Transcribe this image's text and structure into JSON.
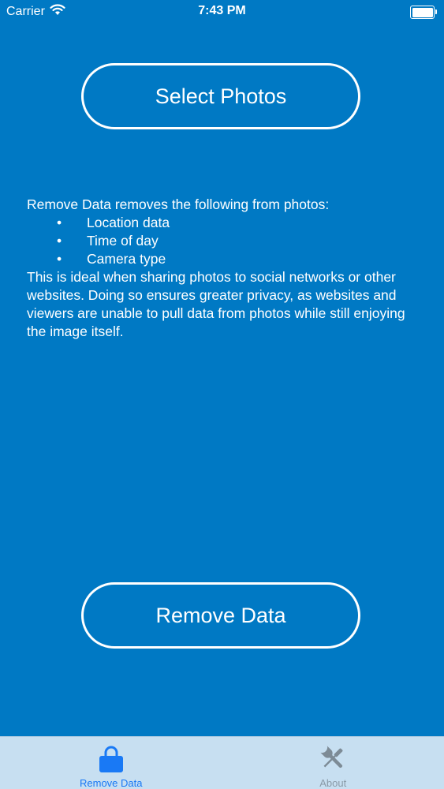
{
  "status_bar": {
    "carrier": "Carrier",
    "time": "7:43 PM",
    "icons": [
      "wifi-icon",
      "battery-icon"
    ]
  },
  "buttons": {
    "select_photos": "Select Photos",
    "remove_data": "Remove Data"
  },
  "description": {
    "intro": "Remove Data removes the following from photos:",
    "items": [
      "Location data",
      "Time of day",
      "Camera type"
    ],
    "bullet": "•",
    "paragraph": "This is ideal when sharing photos to social networks or other websites. Doing so ensures greater privacy, as websites and viewers are unable to pull data from photos while still enjoying the image itself."
  },
  "tab_bar": {
    "tabs": [
      {
        "label": "Remove Data",
        "icon": "lock-icon",
        "active": true
      },
      {
        "label": "About",
        "icon": "tools-icon",
        "active": false
      }
    ]
  },
  "colors": {
    "background": "#0079C4",
    "tab_bar": "#C7DFF1",
    "tab_active": "#1979F5",
    "tab_inactive": "#8a9aa7",
    "text": "#FFFFFF"
  }
}
